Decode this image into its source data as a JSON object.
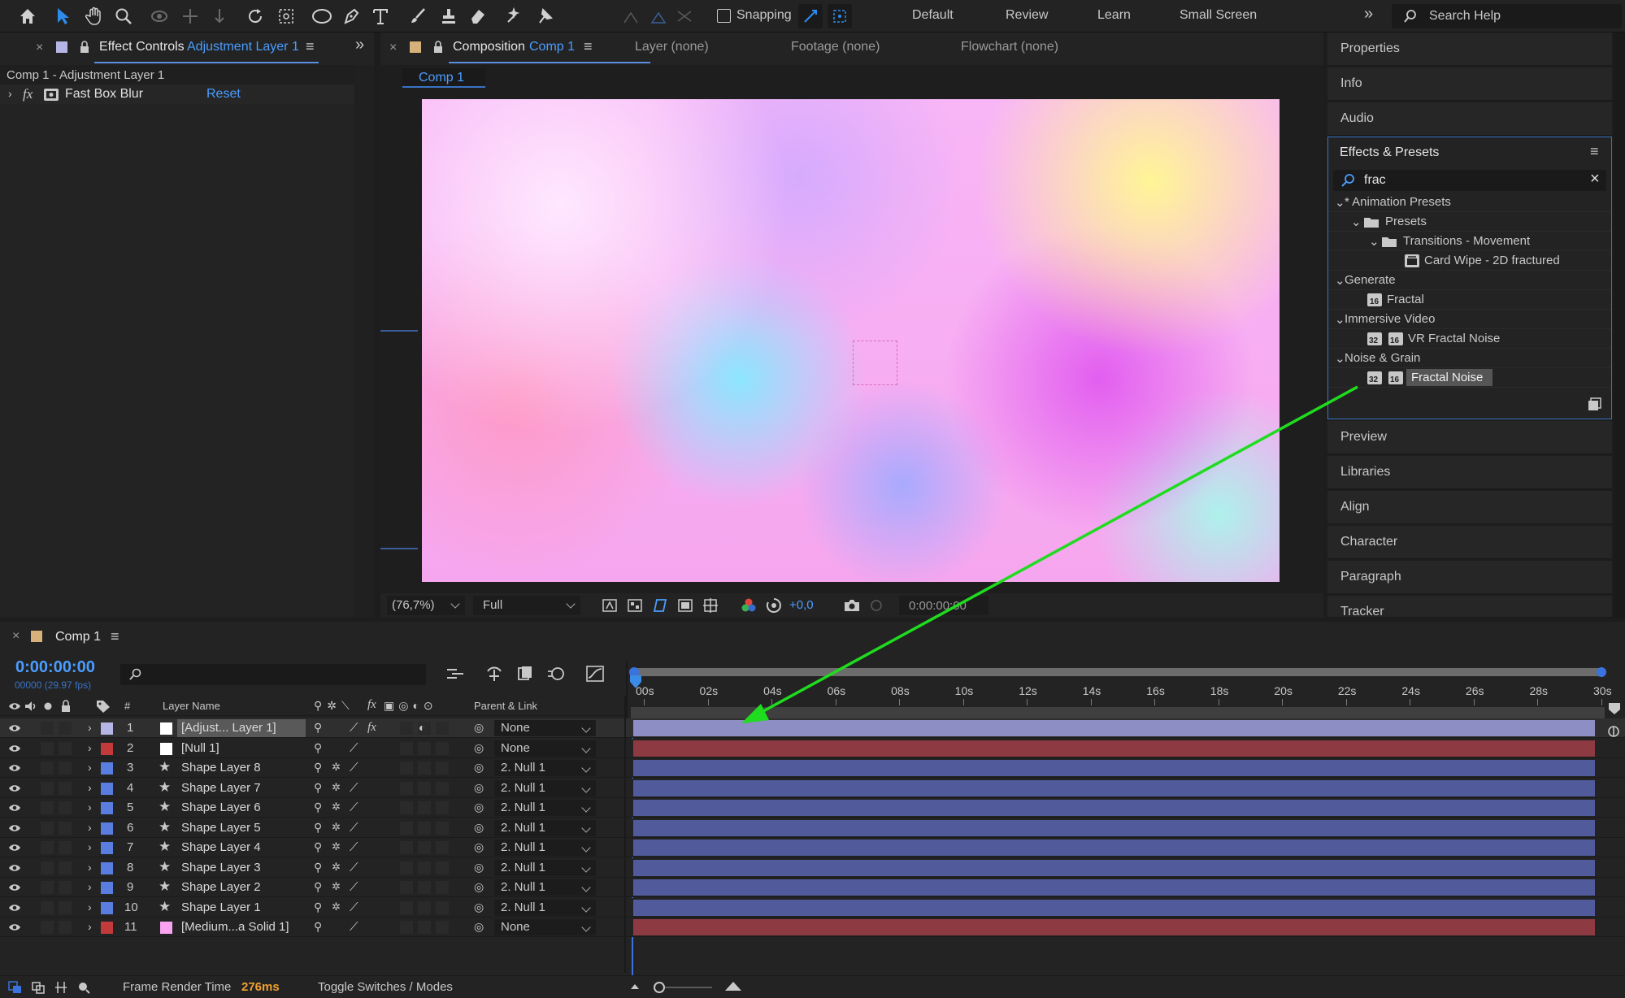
{
  "toolbar": {
    "snapping_label": "Snapping",
    "workspaces": [
      "Default",
      "Review",
      "Learn",
      "Small Screen"
    ],
    "search_placeholder": "Search Help"
  },
  "effect_controls": {
    "tab_label": "Effect Controls",
    "tab_target": "Adjustment Layer 1",
    "breadcrumb": "Comp 1 - Adjustment Layer 1",
    "effect_fx": "fx",
    "effect_name": "Fast Box Blur",
    "reset_label": "Reset"
  },
  "composition": {
    "tab_label": "Composition",
    "tab_target": "Comp 1",
    "other_tabs": [
      "Layer (none)",
      "Footage (none)",
      "Flowchart (none)"
    ],
    "comp_tab": "Comp 1",
    "zoom": "(76,7%)",
    "resolution": "Full",
    "exposure": "+0,0",
    "timecode": "0:00:00:00"
  },
  "right_panels": {
    "items_top": [
      "Properties",
      "Info",
      "Audio"
    ],
    "effects_title": "Effects & Presets",
    "search_value": "frac",
    "tree": [
      {
        "label": "* Animation Presets",
        "type": "group"
      },
      {
        "label": "Presets",
        "type": "folder"
      },
      {
        "label": "Transitions - Movement",
        "type": "folder"
      },
      {
        "label": "Card Wipe - 2D fractured",
        "type": "preset"
      },
      {
        "label": "Generate",
        "type": "group"
      },
      {
        "label": "Fractal",
        "type": "effect"
      },
      {
        "label": "Immersive Video",
        "type": "group"
      },
      {
        "label": "VR Fractal Noise",
        "type": "effect"
      },
      {
        "label": "Noise & Grain",
        "type": "group"
      },
      {
        "label": "Fractal Noise",
        "type": "effect",
        "selected": true
      }
    ],
    "items_bottom": [
      "Preview",
      "Libraries",
      "Align",
      "Character",
      "Paragraph",
      "Tracker"
    ]
  },
  "timeline": {
    "tab_label": "Comp 1",
    "timecode": "0:00:00:00",
    "frames": "00000 (29.97 fps)",
    "col_layer_name": "Layer Name",
    "col_hash": "#",
    "col_parent": "Parent & Link",
    "ruler": [
      "00s",
      "02s",
      "04s",
      "06s",
      "08s",
      "10s",
      "12s",
      "14s",
      "16s",
      "18s",
      "20s",
      "22s",
      "24s",
      "26s",
      "28s",
      "30s"
    ],
    "layers": [
      {
        "num": "1",
        "name": "[Adjust... Layer 1]",
        "parent": "None",
        "label_color": "#b5b5e6",
        "bar_color": "#8c8ec4",
        "swatch": "#ffffff",
        "star": false
      },
      {
        "num": "2",
        "name": "[Null 1]",
        "parent": "None",
        "label_color": "#c23a3a",
        "bar_color": "#8e3a42",
        "swatch": "#ffffff",
        "star": false
      },
      {
        "num": "3",
        "name": "Shape Layer 8",
        "parent": "2. Null 1",
        "label_color": "#5a7de0",
        "bar_color": "#515a9a",
        "star": true
      },
      {
        "num": "4",
        "name": "Shape Layer 7",
        "parent": "2. Null 1",
        "label_color": "#5a7de0",
        "bar_color": "#515a9a",
        "star": true
      },
      {
        "num": "5",
        "name": "Shape Layer 6",
        "parent": "2. Null 1",
        "label_color": "#5a7de0",
        "bar_color": "#515a9a",
        "star": true
      },
      {
        "num": "6",
        "name": "Shape Layer 5",
        "parent": "2. Null 1",
        "label_color": "#5a7de0",
        "bar_color": "#515a9a",
        "star": true
      },
      {
        "num": "7",
        "name": "Shape Layer 4",
        "parent": "2. Null 1",
        "label_color": "#5a7de0",
        "bar_color": "#515a9a",
        "star": true
      },
      {
        "num": "8",
        "name": "Shape Layer 3",
        "parent": "2. Null 1",
        "label_color": "#5a7de0",
        "bar_color": "#515a9a",
        "star": true
      },
      {
        "num": "9",
        "name": "Shape Layer 2",
        "parent": "2. Null 1",
        "label_color": "#5a7de0",
        "bar_color": "#515a9a",
        "star": true
      },
      {
        "num": "10",
        "name": "Shape Layer 1",
        "parent": "2. Null 1",
        "label_color": "#5a7de0",
        "bar_color": "#515a9a",
        "star": true
      },
      {
        "num": "11",
        "name": "[Medium...a Solid 1]",
        "parent": "None",
        "label_color": "#c23a3a",
        "bar_color": "#8e3a42",
        "swatch": "#f7a3f0",
        "star": false
      }
    ],
    "render_time_label": "Frame Render Time",
    "render_time_value": "276ms",
    "toggle_label": "Toggle Switches / Modes"
  },
  "colors": {
    "accent": "#4a9dff",
    "arrow": "#1fdc1f",
    "selected_bg": "#555555"
  }
}
